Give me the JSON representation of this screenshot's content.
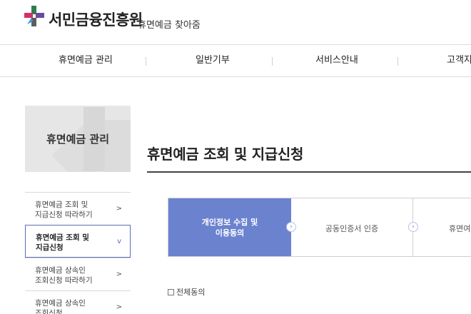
{
  "header": {
    "brand": "서민금융진흥원",
    "subbrand": "휴면예금 찾아줌"
  },
  "gnb": {
    "items": [
      "휴면예금 관리",
      "일반기부",
      "서비스안내",
      "고객지"
    ]
  },
  "sidebar": {
    "title": "휴면예금 관리",
    "items": [
      {
        "line1": "휴면예금 조회 및",
        "line2": "지급신청 따라하기",
        "arrow": ">"
      },
      {
        "line1": "휴면예금 조회 및",
        "line2": "지급신청",
        "arrow": "v"
      },
      {
        "line1": "휴면예금 상속인",
        "line2": "조회신청 따라하기",
        "arrow": ">"
      },
      {
        "line1": "휴면예금 상속인",
        "line2": "조회신청",
        "arrow": ">"
      }
    ]
  },
  "main": {
    "title": "휴면예금 조회 및 지급신청",
    "steps": [
      {
        "line1": "개인정보 수집 및",
        "line2": "이용동의"
      },
      {
        "label": "공동인증서 인증"
      },
      {
        "label": "휴면여"
      }
    ],
    "step_arrow": "›",
    "agree_all": "전체동의"
  },
  "colors": {
    "accent": "#6b82cf",
    "active_border": "#5d6bbd"
  }
}
